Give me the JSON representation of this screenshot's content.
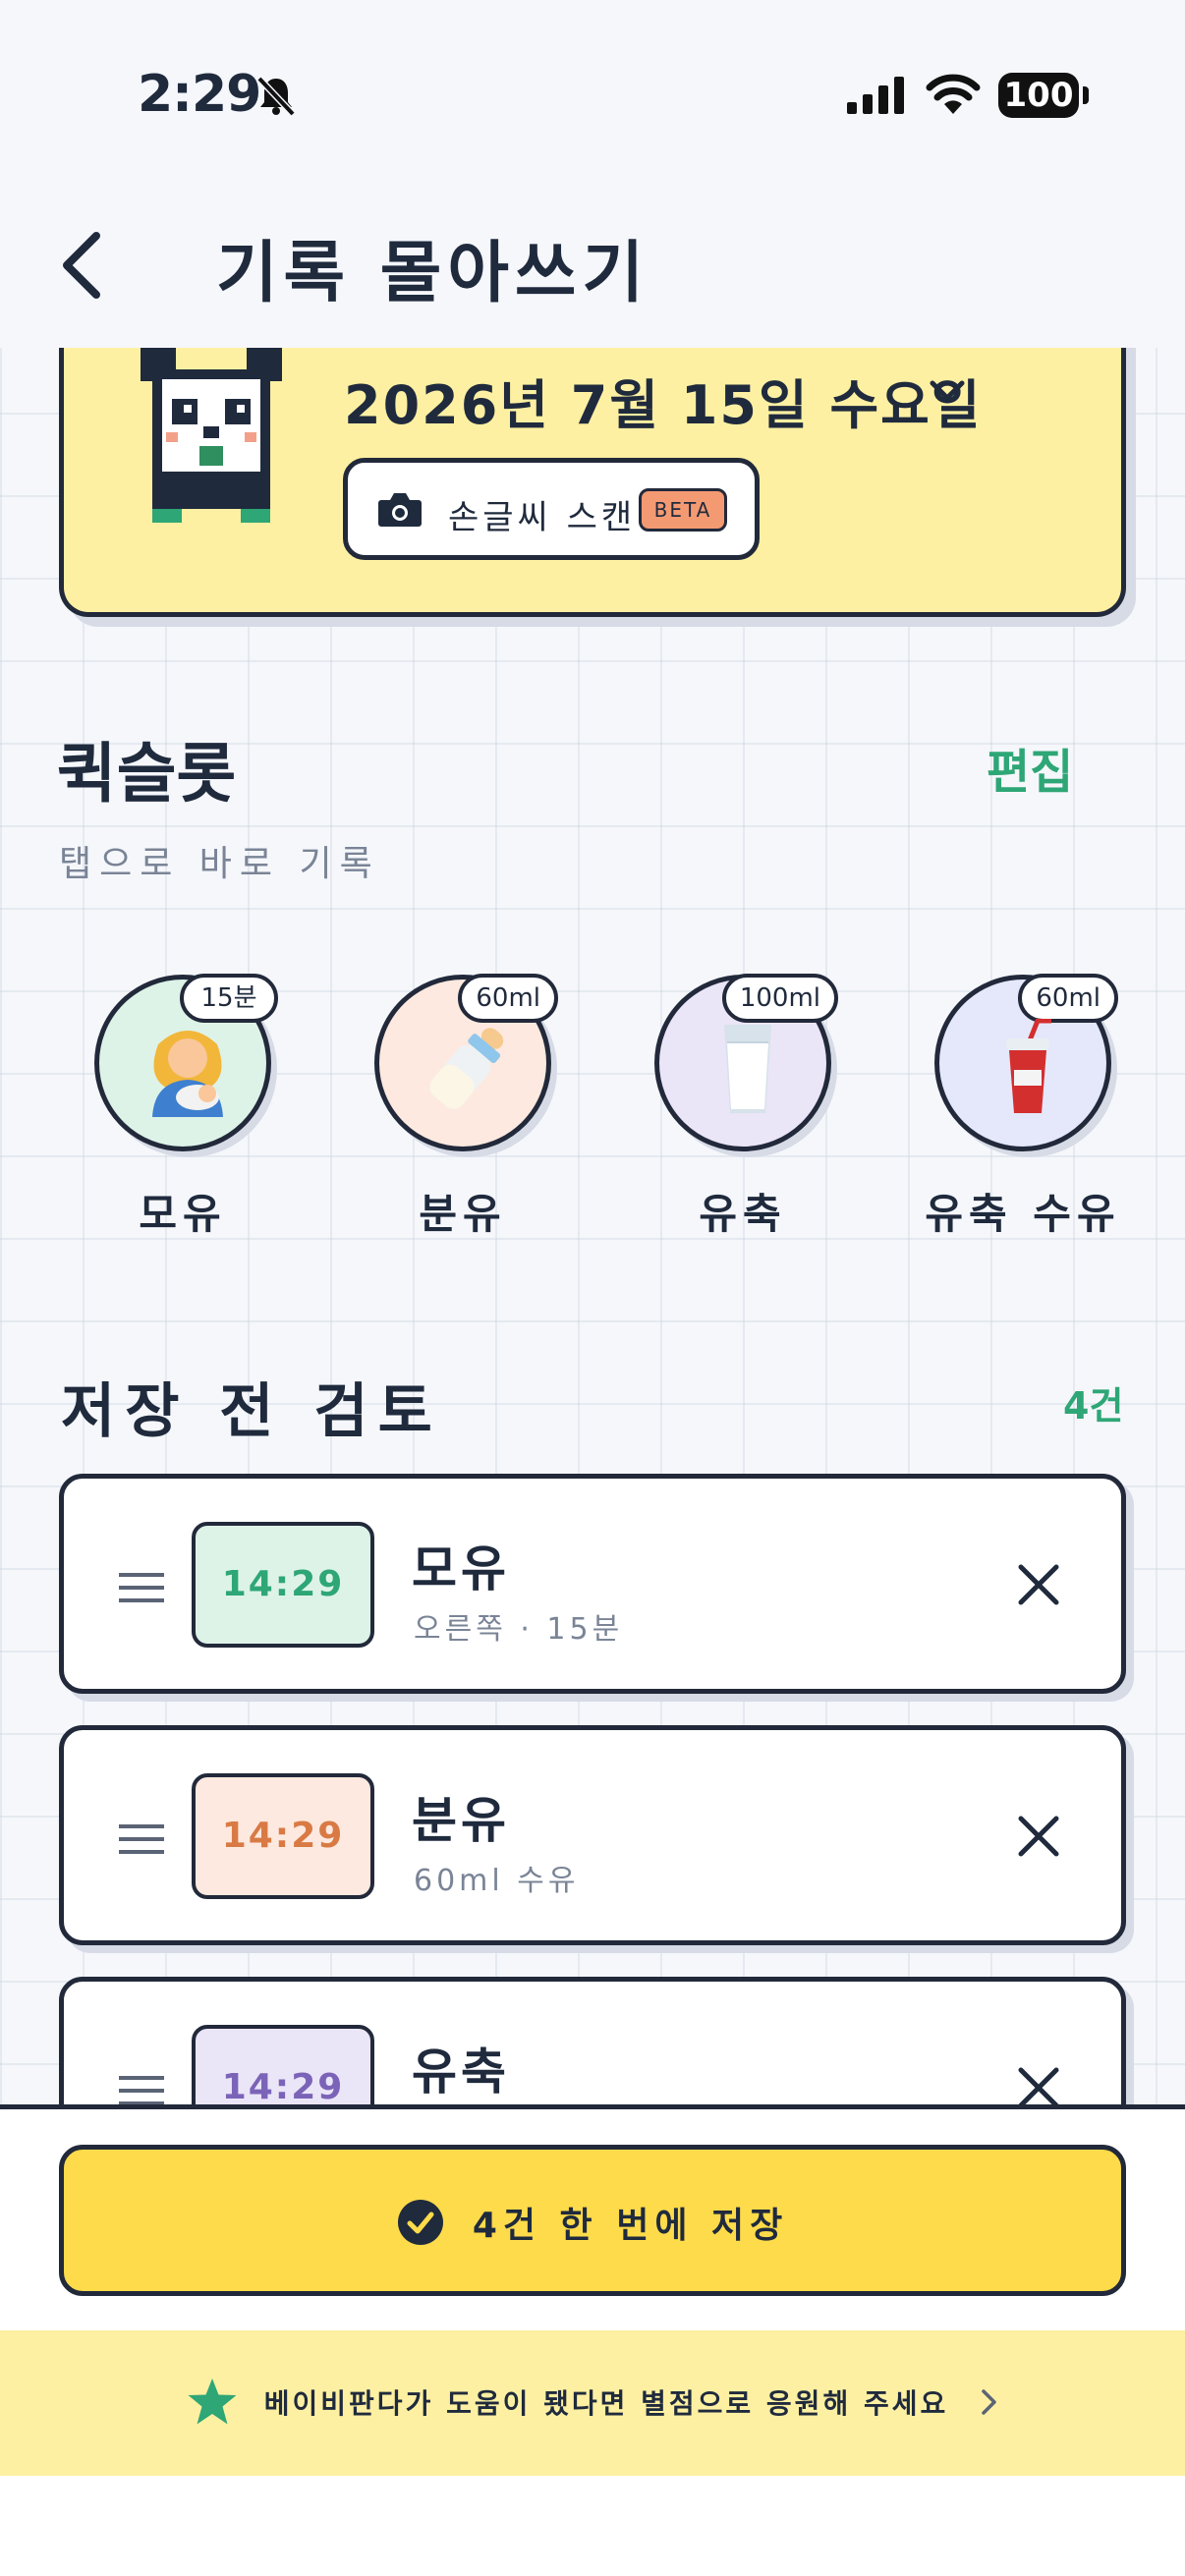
{
  "status_bar": {
    "time": "2:29",
    "battery": "100"
  },
  "header": {
    "title": "기록 몰아쓰기"
  },
  "date_card": {
    "date": "2026년 7월 15일 수요일",
    "scan_label": "손글씨 스캔",
    "beta_badge": "BETA"
  },
  "quickslot": {
    "title": "퀵슬롯",
    "edit": "편집",
    "subtitle": "탭으로 바로 기록",
    "slots": [
      {
        "label": "모유",
        "badge": "15분",
        "icon": "breastfeeding-icon",
        "color": "#ddf3e8"
      },
      {
        "label": "분유",
        "badge": "60ml",
        "icon": "baby-bottle-icon",
        "color": "#fde9df"
      },
      {
        "label": "유축",
        "badge": "100ml",
        "icon": "milk-glass-icon",
        "color": "#ebe5f8"
      },
      {
        "label": "유축 수유",
        "badge": "60ml",
        "icon": "cup-with-straw-icon",
        "color": "#e4e8fa"
      }
    ]
  },
  "review": {
    "title": "저장 전 검토",
    "count": "4건",
    "items": [
      {
        "time": "14:29",
        "name": "모유",
        "detail": "오른쪽 · 15분",
        "time_bg": "#ddf3e8",
        "time_color": "#2ea676"
      },
      {
        "time": "14:29",
        "name": "분유",
        "detail": "60ml 수유",
        "time_bg": "#fde9df",
        "time_color": "#d97a45"
      },
      {
        "time": "14:29",
        "name": "유축",
        "detail": "",
        "time_bg": "#ebe5f8",
        "time_color": "#7b64b8"
      }
    ]
  },
  "save_button": {
    "label": "4건 한 번에 저장"
  },
  "rate_banner": {
    "text": "베이비판다가 도움이 됐다면 별점으로 응원해 주세요"
  }
}
